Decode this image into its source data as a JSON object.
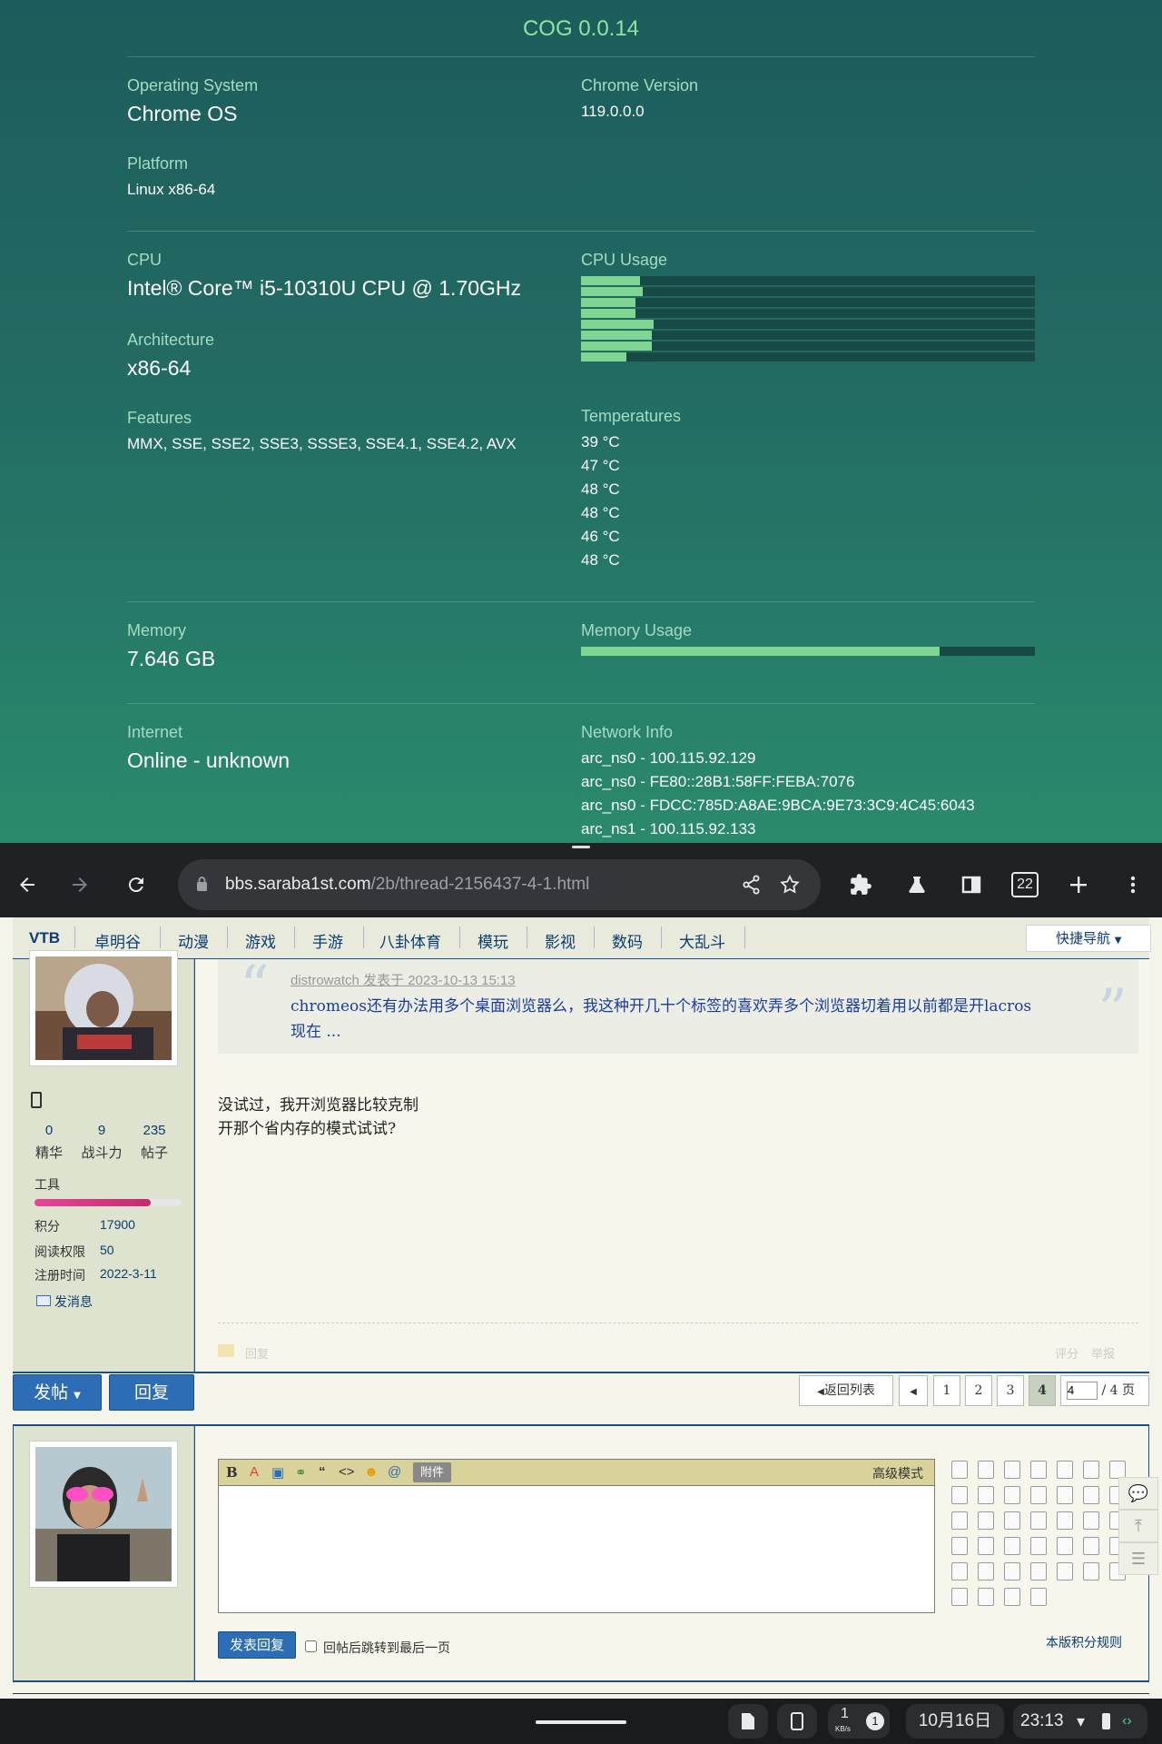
{
  "cog": {
    "title": "COG 0.0.14",
    "os_label": "Operating System",
    "os_value": "Chrome OS",
    "chrome_label": "Chrome Version",
    "chrome_value": "119.0.0.0",
    "platform_label": "Platform",
    "platform_value": "Linux x86-64",
    "cpu_label": "CPU",
    "cpu_value": "Intel® Core™ i5-10310U CPU @ 1.70GHz",
    "cpu_usage_label": "CPU Usage",
    "cpu_usage_fractions": [
      0.13,
      0.135,
      0.12,
      0.12,
      0.16,
      0.155,
      0.155,
      0.1
    ],
    "arch_label": "Architecture",
    "arch_value": "x86-64",
    "features_label": "Features",
    "features_value": "MMX, SSE, SSE2, SSE3, SSSE3, SSE4.1, SSE4.2, AVX",
    "temps_label": "Temperatures",
    "temps": [
      "39 °C",
      "47 °C",
      "48 °C",
      "48 °C",
      "46 °C",
      "48 °C"
    ],
    "memory_label": "Memory",
    "memory_value": "7.646 GB",
    "memory_usage_label": "Memory Usage",
    "memory_usage_fraction": 0.79,
    "internet_label": "Internet",
    "internet_value": "Online - unknown",
    "network_label": "Network Info",
    "network": [
      "arc_ns0 - 100.115.92.129",
      "arc_ns0 - FE80::28B1:58FF:FEBA:7076",
      "arc_ns0 - FDCC:785D:A8AE:9BCA:9E73:3C9:4C45:6043",
      "arc_ns1 - 100.115.92.133"
    ]
  },
  "browser": {
    "url_host": "bbs.saraba1st.com",
    "url_path": "/2b/thread-2156437-4-1.html",
    "tab_count": "22"
  },
  "forum": {
    "nav": [
      "VTB",
      "卓明谷",
      "动漫",
      "游戏",
      "手游",
      "八卦体育",
      "模玩",
      "影视",
      "数码",
      "大乱斗"
    ],
    "quick_nav": "快捷导航",
    "post": {
      "stats": [
        {
          "num": "0",
          "label": "精华"
        },
        {
          "num": "9",
          "label": "战斗力"
        },
        {
          "num": "235",
          "label": "帖子"
        }
      ],
      "group": "工具",
      "level_fraction": 0.79,
      "points_label": "积分",
      "points_value": "17900",
      "read_label": "阅读权限",
      "read_value": "50",
      "reg_label": "注册时间",
      "reg_value": "2022-3-11",
      "message": "发消息",
      "quote_author": "distrowatch 发表于 2023-10-13 15:13",
      "quote_line1": "chromeos还有办法用多个桌面浏览器么，我这种开几十个标签的喜欢弄多个浏览器切着用以前都是开lacros",
      "quote_line2": "现在 ...",
      "reply_line1": "没试过，我开浏览器比较克制",
      "reply_line2": "开那个省内存的模式试试?",
      "reply_link": "回复",
      "rate": "评分",
      "report": "举报"
    },
    "actions": {
      "new_post": "发帖",
      "reply": "回复",
      "back_list": "返回列表",
      "pages": [
        "1",
        "2",
        "3",
        "4"
      ],
      "current_page": "4",
      "page_input": "4",
      "page_total": "/ 4 页"
    },
    "editor": {
      "attach": "附件",
      "advanced": "高级模式",
      "submit": "发表回复",
      "jump_label": "回帖后跳转到最后一页",
      "rules": "本版积分规则"
    }
  },
  "shelf": {
    "net_speed": "1",
    "net_unit": "KB/s",
    "notif_count": "1",
    "date": "10月16日",
    "time": "23:13"
  },
  "colors": {
    "cog_accent": "#8ce6a0",
    "bar_fill": "#7ed692",
    "forum_blue": "#2c6db5",
    "forum_nav_text": "#0b3c72"
  }
}
